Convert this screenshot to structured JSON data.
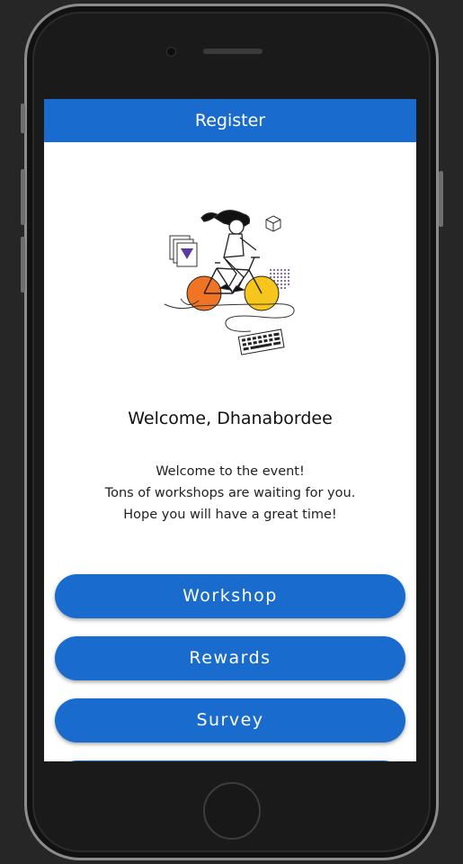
{
  "app_bar": {
    "title": "Register"
  },
  "welcome": {
    "title": "Welcome, Dhanabordee",
    "lines": [
      "Welcome to the event!",
      "Tons of workshops are waiting for you.",
      "Hope you will have a great time!"
    ]
  },
  "menu": {
    "workshop": "Workshop",
    "rewards": "Rewards",
    "survey": "Survey"
  },
  "colors": {
    "primary": "#1a6bce",
    "wheel_orange": "#f07424",
    "wheel_yellow": "#f7c61c",
    "accent_purple": "#5c3a9e"
  },
  "icons": {
    "illustration": "cyclist-illustration"
  }
}
